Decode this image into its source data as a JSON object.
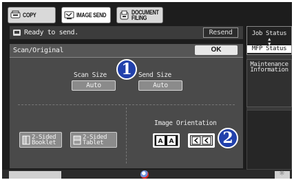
{
  "mode_tabs": [
    {
      "label": "COPY",
      "icon": "copier-icon",
      "active": false
    },
    {
      "label": "IMAGE SEND",
      "icon": "image-send-icon",
      "active": true
    },
    {
      "label": "DOCUMENT\nFILING",
      "icon": "document-filing-icon",
      "active": false
    }
  ],
  "status": {
    "icon": "scanner-status-icon",
    "text": "Ready to send.",
    "resend_label": "Resend"
  },
  "panel": {
    "title": "Scan/Original",
    "ok_label": "OK",
    "scan_size_label": "Scan Size",
    "scan_size_value": "Auto",
    "send_size_label": "Send Size",
    "send_size_value": "Auto",
    "booklet_label": "2-Sided\nBooklet",
    "tablet_label": "2-Sided\nTablet",
    "orientation_label": "Image Orientation",
    "orientation_options": [
      "portrait-orientation-icon",
      "landscape-orientation-icon"
    ],
    "orientation_selected": 1
  },
  "callouts": [
    "1",
    "2"
  ],
  "right_panel": {
    "job_status_label": "Job Status",
    "mfp_status_label": "MFP Status",
    "maintenance_label": "Maintenance\nInformation"
  },
  "colors": {
    "callout": "#2241ac",
    "screen_bg": "#1d1d1d",
    "panel_bg": "#4a4a4a"
  }
}
